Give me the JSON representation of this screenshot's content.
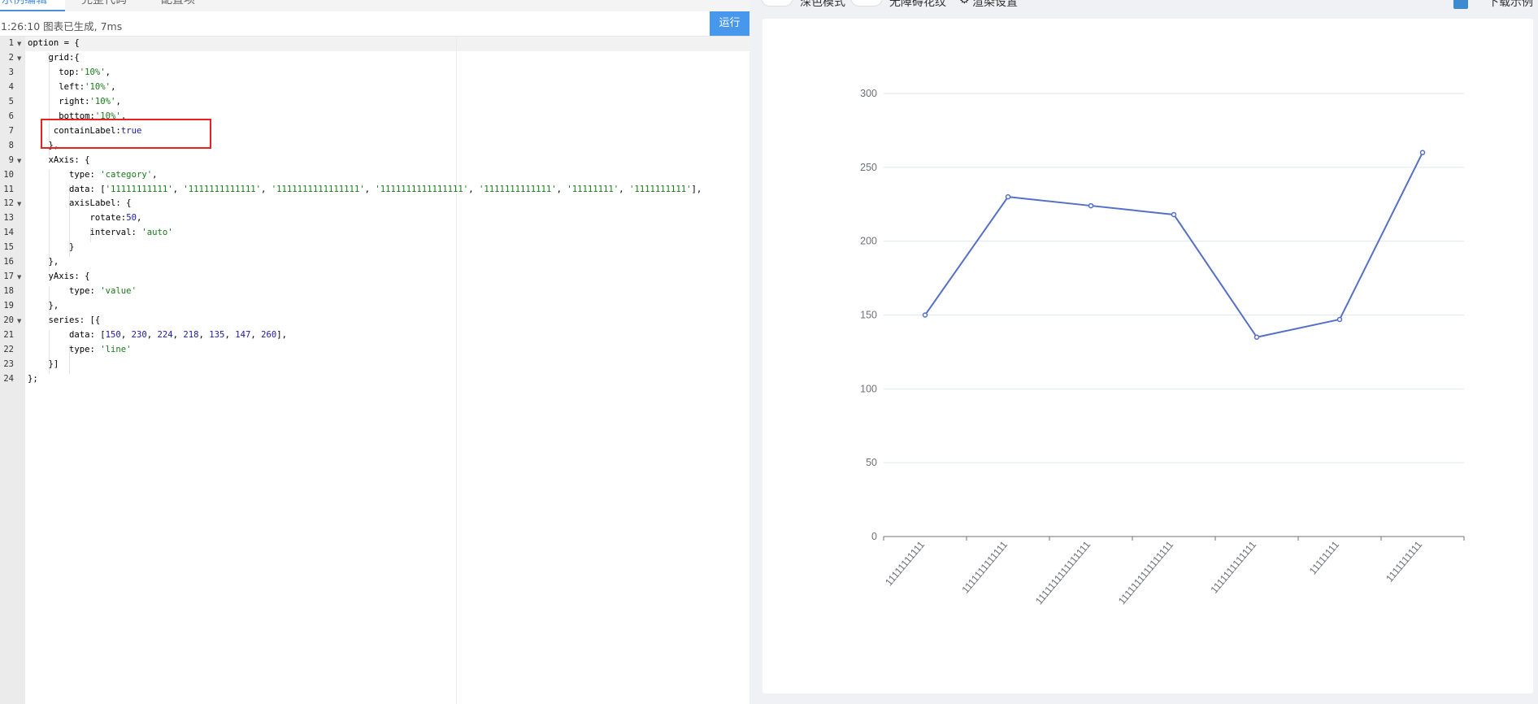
{
  "editor": {
    "tabs": [
      {
        "label": "示例编辑",
        "active": true
      },
      {
        "label": "完整代码",
        "active": false
      },
      {
        "label": "配置项",
        "active": false
      }
    ],
    "status": "1:26:10 图表已生成, 7ms",
    "run_label": "运行",
    "lines": [
      {
        "num": "1",
        "fold": true
      },
      {
        "num": "2",
        "fold": true
      },
      {
        "num": "3"
      },
      {
        "num": "4"
      },
      {
        "num": "5"
      },
      {
        "num": "6"
      },
      {
        "num": "7"
      },
      {
        "num": "8"
      },
      {
        "num": "9",
        "fold": true
      },
      {
        "num": "10"
      },
      {
        "num": "11"
      },
      {
        "num": "12",
        "fold": true
      },
      {
        "num": "13"
      },
      {
        "num": "14"
      },
      {
        "num": "15"
      },
      {
        "num": "16"
      },
      {
        "num": "17",
        "fold": true
      },
      {
        "num": "18"
      },
      {
        "num": "19"
      },
      {
        "num": "20",
        "fold": true
      },
      {
        "num": "21"
      },
      {
        "num": "22"
      },
      {
        "num": "23"
      },
      {
        "num": "24"
      }
    ],
    "code": [
      [
        {
          "t": "option = {",
          "c": "p"
        }
      ],
      [
        {
          "t": "    grid:{",
          "c": "p"
        }
      ],
      [
        {
          "t": "      top:",
          "c": "p"
        },
        {
          "t": "'10%'",
          "c": "s"
        },
        {
          "t": ",",
          "c": "p"
        }
      ],
      [
        {
          "t": "      left:",
          "c": "p"
        },
        {
          "t": "'10%'",
          "c": "s"
        },
        {
          "t": ",",
          "c": "p"
        }
      ],
      [
        {
          "t": "      right:",
          "c": "p"
        },
        {
          "t": "'10%'",
          "c": "s"
        },
        {
          "t": ",",
          "c": "p"
        }
      ],
      [
        {
          "t": "      bottom:",
          "c": "p"
        },
        {
          "t": "'10%'",
          "c": "s"
        },
        {
          "t": ",",
          "c": "p"
        }
      ],
      [
        {
          "t": "     containLabel:",
          "c": "p"
        },
        {
          "t": "true",
          "c": "b"
        }
      ],
      [
        {
          "t": "    },",
          "c": "p"
        }
      ],
      [
        {
          "t": "    xAxis: {",
          "c": "p"
        }
      ],
      [
        {
          "t": "        type: ",
          "c": "p"
        },
        {
          "t": "'category'",
          "c": "s"
        },
        {
          "t": ",",
          "c": "p"
        }
      ],
      [
        {
          "t": "        data: [",
          "c": "p"
        },
        {
          "t": "'11111111111'",
          "c": "s"
        },
        {
          "t": ", ",
          "c": "p"
        },
        {
          "t": "'1111111111111'",
          "c": "s"
        },
        {
          "t": ", ",
          "c": "p"
        },
        {
          "t": "'1111111111111111'",
          "c": "s"
        },
        {
          "t": ", ",
          "c": "p"
        },
        {
          "t": "'1111111111111111'",
          "c": "s"
        },
        {
          "t": ", ",
          "c": "p"
        },
        {
          "t": "'1111111111111'",
          "c": "s"
        },
        {
          "t": ", ",
          "c": "p"
        },
        {
          "t": "'11111111'",
          "c": "s"
        },
        {
          "t": ", ",
          "c": "p"
        },
        {
          "t": "'1111111111'",
          "c": "s"
        },
        {
          "t": "],",
          "c": "p"
        }
      ],
      [
        {
          "t": "        axisLabel: {",
          "c": "p"
        }
      ],
      [
        {
          "t": "            rotate:",
          "c": "p"
        },
        {
          "t": "50",
          "c": "n"
        },
        {
          "t": ",",
          "c": "p"
        }
      ],
      [
        {
          "t": "            interval: ",
          "c": "p"
        },
        {
          "t": "'auto'",
          "c": "s"
        }
      ],
      [
        {
          "t": "        }",
          "c": "p"
        }
      ],
      [
        {
          "t": "    },",
          "c": "p"
        }
      ],
      [
        {
          "t": "    yAxis: {",
          "c": "p"
        }
      ],
      [
        {
          "t": "        type: ",
          "c": "p"
        },
        {
          "t": "'value'",
          "c": "s"
        }
      ],
      [
        {
          "t": "    },",
          "c": "p"
        }
      ],
      [
        {
          "t": "    series: [{",
          "c": "p"
        }
      ],
      [
        {
          "t": "        data: [",
          "c": "p"
        },
        {
          "t": "150",
          "c": "n"
        },
        {
          "t": ", ",
          "c": "p"
        },
        {
          "t": "230",
          "c": "n"
        },
        {
          "t": ", ",
          "c": "p"
        },
        {
          "t": "224",
          "c": "n"
        },
        {
          "t": ", ",
          "c": "p"
        },
        {
          "t": "218",
          "c": "n"
        },
        {
          "t": ", ",
          "c": "p"
        },
        {
          "t": "135",
          "c": "n"
        },
        {
          "t": ", ",
          "c": "p"
        },
        {
          "t": "147",
          "c": "n"
        },
        {
          "t": ", ",
          "c": "p"
        },
        {
          "t": "260",
          "c": "n"
        },
        {
          "t": "],",
          "c": "p"
        }
      ],
      [
        {
          "t": "        type: ",
          "c": "p"
        },
        {
          "t": "'line'",
          "c": "s"
        }
      ],
      [
        {
          "t": "    }]",
          "c": "p"
        }
      ],
      [
        {
          "t": "};",
          "c": "p"
        }
      ]
    ]
  },
  "preview": {
    "toolbar": {
      "dark_mode_label": "深色模式",
      "no_animation_label": "无障碍花纹",
      "settings_label": "渲染设置",
      "download_label": "下载示例"
    }
  },
  "colors": {
    "accent": "#4797ec",
    "series": "#5470c6",
    "highlight": "#e8231f"
  },
  "chart_data": {
    "type": "line",
    "categories": [
      "11111111111",
      "1111111111111",
      "1111111111111111",
      "1111111111111111",
      "1111111111111",
      "11111111",
      "1111111111"
    ],
    "series": [
      {
        "values": [
          150,
          230,
          224,
          218,
          135,
          147,
          260
        ]
      }
    ],
    "ylim": [
      0,
      300
    ],
    "yticks": [
      "0",
      "50",
      "100",
      "150",
      "200",
      "250",
      "300"
    ],
    "x_label_rotate": 50,
    "grid": true
  }
}
